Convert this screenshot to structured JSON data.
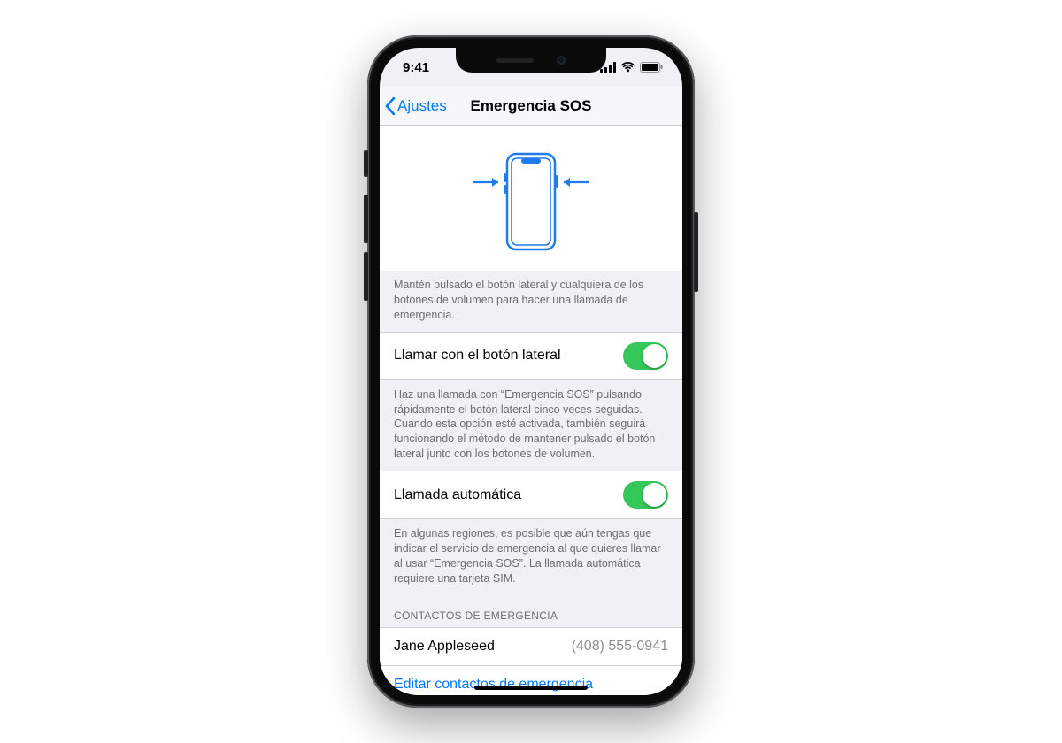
{
  "status": {
    "time": "9:41"
  },
  "nav": {
    "back": "Ajustes",
    "title": "Emergencia SOS"
  },
  "illustration_footer": "Mantén pulsado el botón lateral y cualquiera de los botones de volumen para hacer una llamada de emergencia.",
  "setting1": {
    "label": "Llamar con el botón lateral",
    "footer": "Haz una llamada con “Emergencia SOS” pulsando rápidamente el botón lateral cinco veces seguidas. Cuando esta opción esté activada, también seguirá funcionando el método de mantener pulsado el botón lateral junto con los botones de volumen."
  },
  "setting2": {
    "label": "Llamada automática",
    "footer": "En algunas regiones, es posible que aún tengas que indicar el servicio de emergencia al que quieres llamar al usar “Emergencia SOS”. La llamada automática requiere una tarjeta SIM."
  },
  "contacts": {
    "header": "CONTACTOS DE EMERGENCIA",
    "items": [
      {
        "name": "Jane Appleseed",
        "phone": "(408) 555-0941"
      }
    ],
    "edit": "Editar contactos de emergencia"
  }
}
